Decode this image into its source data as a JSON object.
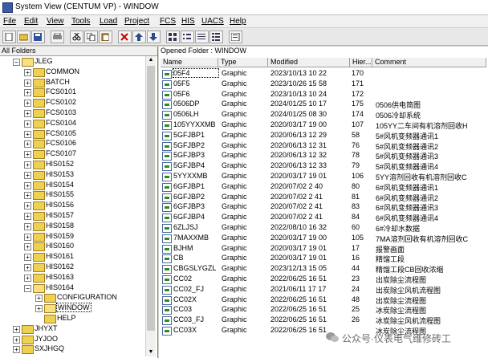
{
  "window": {
    "title": "System View (CENTUM VP) - WINDOW"
  },
  "menu": [
    "File",
    "Edit",
    "View",
    "Tools",
    "Load",
    "Project",
    "FCS",
    "HIS",
    "UACS",
    "Help"
  ],
  "tree": {
    "header": "All Folders",
    "items": [
      {
        "label": "JLEG",
        "level": 0,
        "exp": "−",
        "open": true
      },
      {
        "label": "COMMON",
        "level": 1,
        "exp": "+"
      },
      {
        "label": "BATCH",
        "level": 1,
        "exp": "+"
      },
      {
        "label": "FCS0101",
        "level": 1,
        "exp": "+"
      },
      {
        "label": "FCS0102",
        "level": 1,
        "exp": "+"
      },
      {
        "label": "FCS0103",
        "level": 1,
        "exp": "+"
      },
      {
        "label": "FCS0104",
        "level": 1,
        "exp": "+"
      },
      {
        "label": "FCS0105",
        "level": 1,
        "exp": "+"
      },
      {
        "label": "FCS0106",
        "level": 1,
        "exp": "+"
      },
      {
        "label": "FCS0107",
        "level": 1,
        "exp": "+"
      },
      {
        "label": "HIS0152",
        "level": 1,
        "exp": "+"
      },
      {
        "label": "HIS0153",
        "level": 1,
        "exp": "+"
      },
      {
        "label": "HIS0154",
        "level": 1,
        "exp": "+"
      },
      {
        "label": "HIS0155",
        "level": 1,
        "exp": "+"
      },
      {
        "label": "HIS0156",
        "level": 1,
        "exp": "+"
      },
      {
        "label": "HIS0157",
        "level": 1,
        "exp": "+"
      },
      {
        "label": "HIS0158",
        "level": 1,
        "exp": "+"
      },
      {
        "label": "HIS0159",
        "level": 1,
        "exp": "+"
      },
      {
        "label": "HIS0160",
        "level": 1,
        "exp": "+"
      },
      {
        "label": "HIS0161",
        "level": 1,
        "exp": "+"
      },
      {
        "label": "HIS0162",
        "level": 1,
        "exp": "+"
      },
      {
        "label": "HIS0163",
        "level": 1,
        "exp": "+"
      },
      {
        "label": "HIS0164",
        "level": 1,
        "exp": "−",
        "open": true
      },
      {
        "label": "CONFIGURATION",
        "level": 2,
        "exp": "+"
      },
      {
        "label": "WINDOW",
        "level": 2,
        "exp": "+",
        "sel": true,
        "open": true
      },
      {
        "label": "HELP",
        "level": 2,
        "exp": ""
      },
      {
        "label": "JHYXT",
        "level": 0,
        "exp": "+"
      },
      {
        "label": "JYJOO",
        "level": 0,
        "exp": "+"
      },
      {
        "label": "SXJHGQ",
        "level": 0,
        "exp": "+"
      }
    ]
  },
  "list": {
    "opened_label": "Opened Folder : WINDOW",
    "columns": [
      "Name",
      "Type",
      "Modified",
      "Hier...",
      "Comment"
    ],
    "rows": [
      [
        "05F4",
        "Graphic",
        "2023/10/13 10 22",
        "170",
        ""
      ],
      [
        "05F5",
        "Graphic",
        "2023/10/26 15 58",
        "171",
        ""
      ],
      [
        "05F6",
        "Graphic",
        "2023/10/13 10 24",
        "172",
        ""
      ],
      [
        "0506DP",
        "Graphic",
        "2024/01/25 10 17",
        "175",
        "0506供电简图"
      ],
      [
        "0506LH",
        "Graphic",
        "2024/01/25 08 30",
        "174",
        "0506冷却系统"
      ],
      [
        "105YYXXMB",
        "Graphic",
        "2020/03/17 19 00",
        "107",
        "105YY二车间有机溶剂回收H"
      ],
      [
        "5GFJBP1",
        "Graphic",
        "2020/06/13 12 29",
        "58",
        "5#风机变频器通讯1"
      ],
      [
        "5GFJBP2",
        "Graphic",
        "2020/06/13 12 31",
        "76",
        "5#风机变频器通讯2"
      ],
      [
        "5GFJBP3",
        "Graphic",
        "2020/06/13 12 32",
        "78",
        "5#风机变频器通讯3"
      ],
      [
        "5GFJBP4",
        "Graphic",
        "2020/06/13 12 33",
        "79",
        "5#风机变频器通讯4"
      ],
      [
        "5YYXXMB",
        "Graphic",
        "2020/03/17 19 01",
        "106",
        "5YY溶剂回收有机溶剂回收C"
      ],
      [
        "6GFJBP1",
        "Graphic",
        "2020/07/02 2 40",
        "80",
        "6#风机变频器通讯1"
      ],
      [
        "6GFJBP2",
        "Graphic",
        "2020/07/02 2 41",
        "81",
        "6#风机变频器通讯2"
      ],
      [
        "6GFJBP3",
        "Graphic",
        "2020/07/02 2 41",
        "83",
        "6#风机变频器通讯3"
      ],
      [
        "6GFJBP4",
        "Graphic",
        "2020/07/02 2 41",
        "84",
        "6#风机变频器通讯4"
      ],
      [
        "6ZLJSJ",
        "Graphic",
        "2022/08/10 16 32",
        "60",
        "6#冷却水数据"
      ],
      [
        "7MAXXMB",
        "Graphic",
        "2020/03/17 19 00",
        "105",
        "7MA溶剂回收有机溶剂回收C"
      ],
      [
        "BJHM",
        "Graphic",
        "2020/03/17 19 01",
        "17",
        "报警画面"
      ],
      [
        "CB",
        "Graphic",
        "2020/03/17 19 01",
        "16",
        "精馏工段"
      ],
      [
        "CBGSLYGZL",
        "Graphic",
        "2023/12/13 15 05",
        "44",
        "精馏工段CB回收浓缩"
      ],
      [
        "CC02",
        "Graphic",
        "2022/06/25 16 51",
        "23",
        "出炭除尘流程图"
      ],
      [
        "CC02_FJ",
        "Graphic",
        "2021/06/11 17 17",
        "24",
        "出炭除尘风机流程图"
      ],
      [
        "CC02X",
        "Graphic",
        "2022/06/25 16 51",
        "48",
        "出炭除尘流程图"
      ],
      [
        "CC03",
        "Graphic",
        "2022/06/25 16 51",
        "25",
        "冰炭除尘流程图"
      ],
      [
        "CC03_FJ",
        "Graphic",
        "2022/06/25 16 51",
        "26",
        "冰炭除尘风机流程图"
      ],
      [
        "CC03X",
        "Graphic",
        "2022/06/25 16 51",
        "",
        "冰炭除尘流程图"
      ]
    ]
  },
  "watermark": {
    "text": "公众号·仪表电气维修砖工"
  }
}
